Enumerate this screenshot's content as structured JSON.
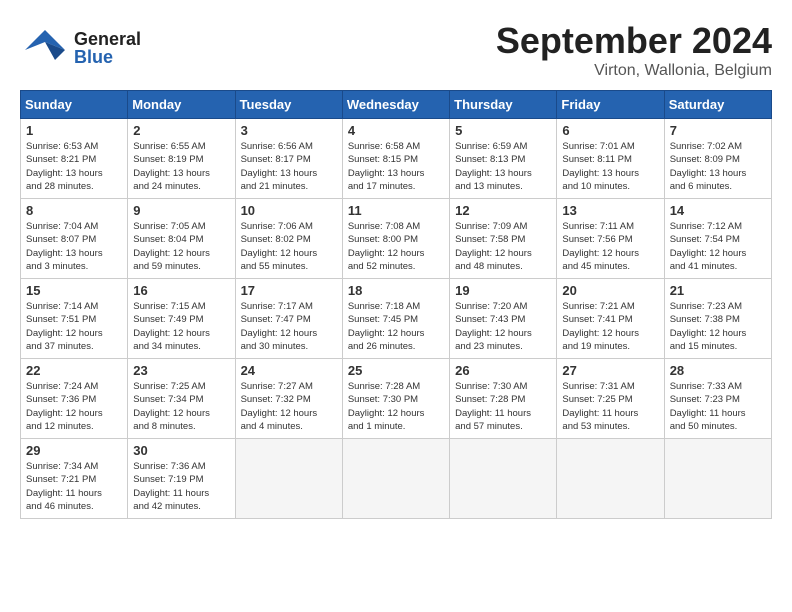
{
  "header": {
    "logo_general": "General",
    "logo_blue": "Blue",
    "month_year": "September 2024",
    "location": "Virton, Wallonia, Belgium"
  },
  "weekdays": [
    "Sunday",
    "Monday",
    "Tuesday",
    "Wednesday",
    "Thursday",
    "Friday",
    "Saturday"
  ],
  "days": [
    {
      "date": "",
      "info": ""
    },
    {
      "date": "",
      "info": ""
    },
    {
      "date": "",
      "info": ""
    },
    {
      "date": "",
      "info": ""
    },
    {
      "date": "",
      "info": ""
    },
    {
      "date": "",
      "info": ""
    },
    {
      "date": "1",
      "info": "Sunrise: 6:53 AM\nSunset: 8:21 PM\nDaylight: 13 hours\nand 28 minutes."
    },
    {
      "date": "2",
      "info": "Sunrise: 6:55 AM\nSunset: 8:19 PM\nDaylight: 13 hours\nand 24 minutes."
    },
    {
      "date": "3",
      "info": "Sunrise: 6:56 AM\nSunset: 8:17 PM\nDaylight: 13 hours\nand 21 minutes."
    },
    {
      "date": "4",
      "info": "Sunrise: 6:58 AM\nSunset: 8:15 PM\nDaylight: 13 hours\nand 17 minutes."
    },
    {
      "date": "5",
      "info": "Sunrise: 6:59 AM\nSunset: 8:13 PM\nDaylight: 13 hours\nand 13 minutes."
    },
    {
      "date": "6",
      "info": "Sunrise: 7:01 AM\nSunset: 8:11 PM\nDaylight: 13 hours\nand 10 minutes."
    },
    {
      "date": "7",
      "info": "Sunrise: 7:02 AM\nSunset: 8:09 PM\nDaylight: 13 hours\nand 6 minutes."
    },
    {
      "date": "8",
      "info": "Sunrise: 7:04 AM\nSunset: 8:07 PM\nDaylight: 13 hours\nand 3 minutes."
    },
    {
      "date": "9",
      "info": "Sunrise: 7:05 AM\nSunset: 8:04 PM\nDaylight: 12 hours\nand 59 minutes."
    },
    {
      "date": "10",
      "info": "Sunrise: 7:06 AM\nSunset: 8:02 PM\nDaylight: 12 hours\nand 55 minutes."
    },
    {
      "date": "11",
      "info": "Sunrise: 7:08 AM\nSunset: 8:00 PM\nDaylight: 12 hours\nand 52 minutes."
    },
    {
      "date": "12",
      "info": "Sunrise: 7:09 AM\nSunset: 7:58 PM\nDaylight: 12 hours\nand 48 minutes."
    },
    {
      "date": "13",
      "info": "Sunrise: 7:11 AM\nSunset: 7:56 PM\nDaylight: 12 hours\nand 45 minutes."
    },
    {
      "date": "14",
      "info": "Sunrise: 7:12 AM\nSunset: 7:54 PM\nDaylight: 12 hours\nand 41 minutes."
    },
    {
      "date": "15",
      "info": "Sunrise: 7:14 AM\nSunset: 7:51 PM\nDaylight: 12 hours\nand 37 minutes."
    },
    {
      "date": "16",
      "info": "Sunrise: 7:15 AM\nSunset: 7:49 PM\nDaylight: 12 hours\nand 34 minutes."
    },
    {
      "date": "17",
      "info": "Sunrise: 7:17 AM\nSunset: 7:47 PM\nDaylight: 12 hours\nand 30 minutes."
    },
    {
      "date": "18",
      "info": "Sunrise: 7:18 AM\nSunset: 7:45 PM\nDaylight: 12 hours\nand 26 minutes."
    },
    {
      "date": "19",
      "info": "Sunrise: 7:20 AM\nSunset: 7:43 PM\nDaylight: 12 hours\nand 23 minutes."
    },
    {
      "date": "20",
      "info": "Sunrise: 7:21 AM\nSunset: 7:41 PM\nDaylight: 12 hours\nand 19 minutes."
    },
    {
      "date": "21",
      "info": "Sunrise: 7:23 AM\nSunset: 7:38 PM\nDaylight: 12 hours\nand 15 minutes."
    },
    {
      "date": "22",
      "info": "Sunrise: 7:24 AM\nSunset: 7:36 PM\nDaylight: 12 hours\nand 12 minutes."
    },
    {
      "date": "23",
      "info": "Sunrise: 7:25 AM\nSunset: 7:34 PM\nDaylight: 12 hours\nand 8 minutes."
    },
    {
      "date": "24",
      "info": "Sunrise: 7:27 AM\nSunset: 7:32 PM\nDaylight: 12 hours\nand 4 minutes."
    },
    {
      "date": "25",
      "info": "Sunrise: 7:28 AM\nSunset: 7:30 PM\nDaylight: 12 hours\nand 1 minute."
    },
    {
      "date": "26",
      "info": "Sunrise: 7:30 AM\nSunset: 7:28 PM\nDaylight: 11 hours\nand 57 minutes."
    },
    {
      "date": "27",
      "info": "Sunrise: 7:31 AM\nSunset: 7:25 PM\nDaylight: 11 hours\nand 53 minutes."
    },
    {
      "date": "28",
      "info": "Sunrise: 7:33 AM\nSunset: 7:23 PM\nDaylight: 11 hours\nand 50 minutes."
    },
    {
      "date": "29",
      "info": "Sunrise: 7:34 AM\nSunset: 7:21 PM\nDaylight: 11 hours\nand 46 minutes."
    },
    {
      "date": "30",
      "info": "Sunrise: 7:36 AM\nSunset: 7:19 PM\nDaylight: 11 hours\nand 42 minutes."
    },
    {
      "date": "",
      "info": ""
    },
    {
      "date": "",
      "info": ""
    },
    {
      "date": "",
      "info": ""
    },
    {
      "date": "",
      "info": ""
    },
    {
      "date": "",
      "info": ""
    }
  ]
}
